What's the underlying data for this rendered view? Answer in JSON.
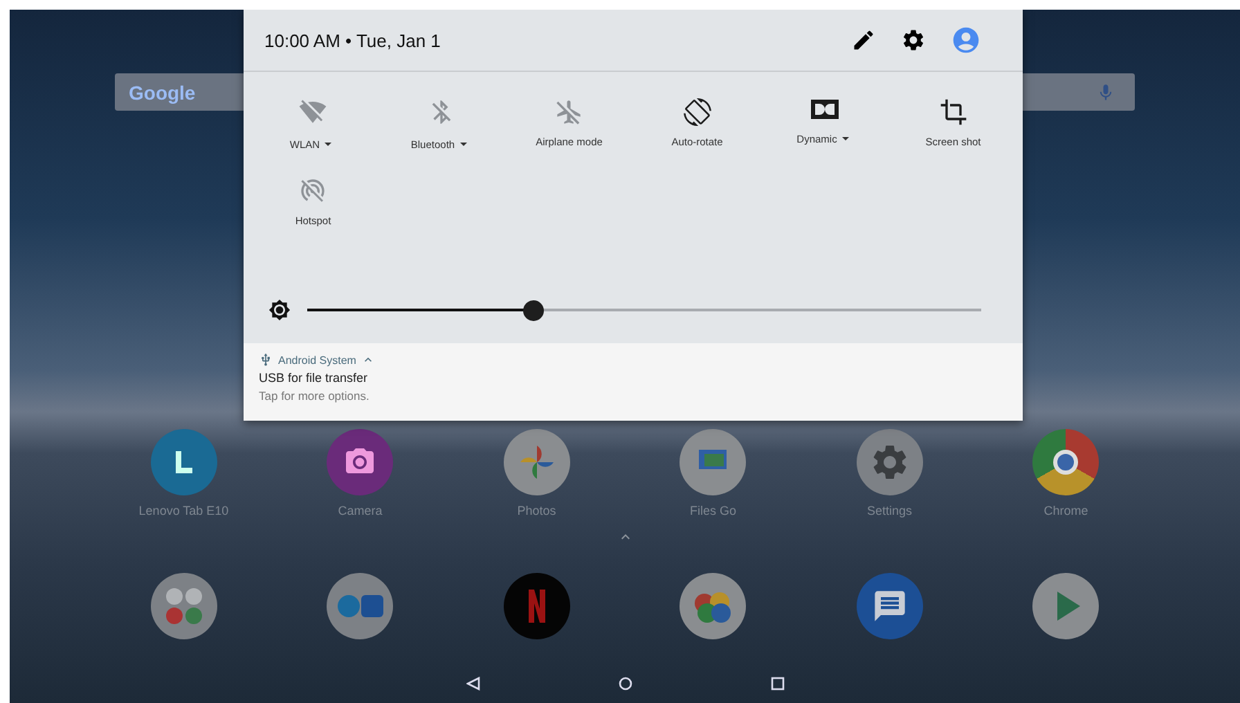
{
  "status_panel": {
    "time_date": "10:00 AM • Tue, Jan 1"
  },
  "quick_tiles": [
    {
      "label": "WLAN",
      "on": false,
      "dropdown": true
    },
    {
      "label": "Bluetooth",
      "on": false,
      "dropdown": true
    },
    {
      "label": "Airplane mode",
      "on": false,
      "dropdown": false
    },
    {
      "label": "Auto-rotate",
      "on": true,
      "dropdown": false
    },
    {
      "label": "Dynamic",
      "on": true,
      "dropdown": true
    },
    {
      "label": "Screen shot",
      "on": true,
      "dropdown": false
    },
    {
      "label": "Hotspot",
      "on": false,
      "dropdown": false
    }
  ],
  "brightness": {
    "level": 0.33
  },
  "notification": {
    "app": "Android System",
    "title": "USB for file transfer",
    "text": "Tap for more options."
  },
  "search_bar": {
    "logo": "Google"
  },
  "apps": [
    {
      "label": "Lenovo Tab E10"
    },
    {
      "label": "Camera"
    },
    {
      "label": "Photos"
    },
    {
      "label": "Files Go"
    },
    {
      "label": "Settings"
    },
    {
      "label": "Chrome"
    }
  ]
}
